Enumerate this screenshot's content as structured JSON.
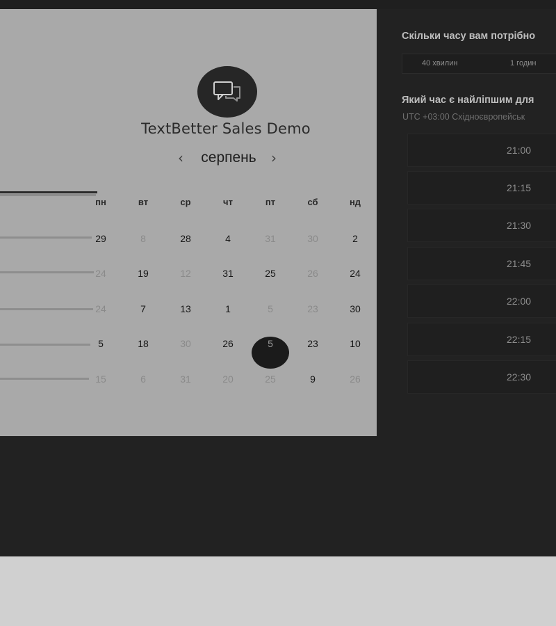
{
  "event": {
    "title": "TextBetter Sales Demo",
    "avatar_icon": "chat-bubbles-icon"
  },
  "calendar": {
    "month": "серпень",
    "prev_icon": "‹",
    "next_icon": "›",
    "weekdays": [
      "пн",
      "вт",
      "ср",
      "чт",
      "пт",
      "сб",
      "нд"
    ],
    "weeks": [
      [
        "29",
        "8",
        "28",
        "4",
        "31",
        "30",
        "2"
      ],
      [
        "24",
        "19",
        "12",
        "31",
        "25",
        "26",
        "24"
      ],
      [
        "24",
        "7",
        "13",
        "1",
        "5",
        "23",
        "30"
      ],
      [
        "5",
        "18",
        "30",
        "26",
        "5",
        "23",
        "10"
      ],
      [
        "15",
        "6",
        "31",
        "20",
        "25",
        "9",
        "26"
      ]
    ],
    "selected_day": "5"
  },
  "duration": {
    "question": "Скільки часу вам потрібно",
    "options": [
      "40 хвилин",
      "1 годин"
    ]
  },
  "timeslots": {
    "question": "Який час є найліпшим для",
    "timezone": "UTC +03:00 Східноєвропейськ",
    "slots": [
      "21:00",
      "21:15",
      "21:30",
      "21:45",
      "22:00",
      "22:15",
      "22:30"
    ]
  },
  "colors": {
    "selected_day_bg": "#1b1b1b",
    "panel_bg": "#a9a9a9",
    "page_bg": "#222222"
  }
}
